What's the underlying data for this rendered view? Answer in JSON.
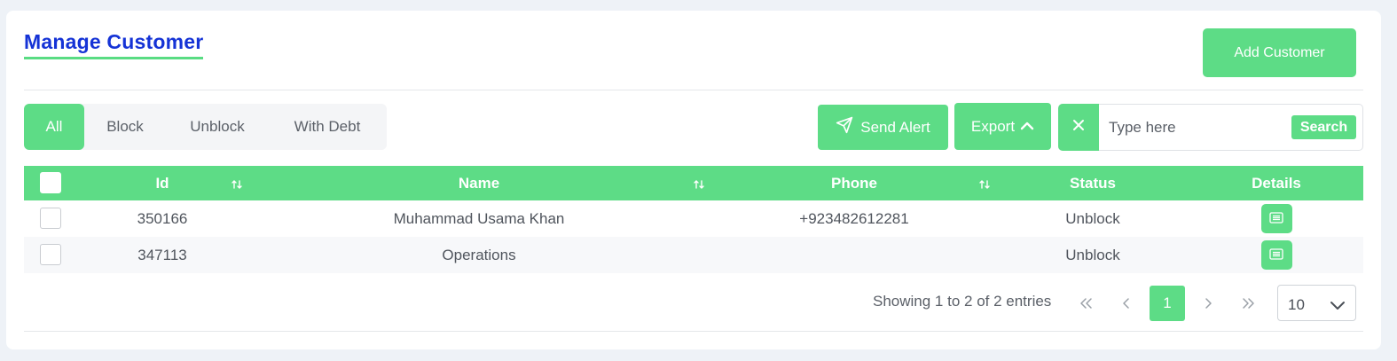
{
  "page": {
    "title": "Manage Customer",
    "add_button": "Add Customer"
  },
  "filters": {
    "tabs": [
      {
        "label": "All",
        "active": true
      },
      {
        "label": "Block",
        "active": false
      },
      {
        "label": "Unblock",
        "active": false
      },
      {
        "label": "With Debt",
        "active": false
      }
    ]
  },
  "toolbar": {
    "send_alert_label": "Send Alert",
    "export_label": "Export",
    "search_placeholder": "Type here",
    "search_button": "Search"
  },
  "table": {
    "columns": [
      "Id",
      "Name",
      "Phone",
      "Status",
      "Details"
    ],
    "rows": [
      {
        "id": "350166",
        "name": "Muhammad Usama Khan",
        "phone": "+923482612281",
        "status": "Unblock"
      },
      {
        "id": "347113",
        "name": "Operations",
        "phone": "",
        "status": "Unblock"
      }
    ]
  },
  "pagination": {
    "summary": "Showing 1 to 2 of 2 entries",
    "first": "«",
    "prev": "‹",
    "current_page": "1",
    "next": "›",
    "last": "»",
    "page_size": "10"
  },
  "colors": {
    "accent": "#5ddc86",
    "title": "#1533d6"
  },
  "icons": {
    "send": "send-plane-icon",
    "export": "chevron-up-icon",
    "clear": "close-icon",
    "sort": "sort-arrows-icon",
    "details": "details-icon",
    "page_size": "chevron-down-icon"
  }
}
